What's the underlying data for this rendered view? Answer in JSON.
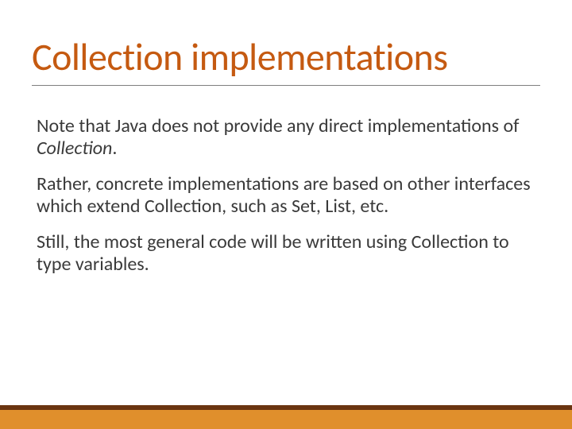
{
  "title": "Collection implementations",
  "para1_a": "Note that Java does not provide any direct implementations of ",
  "para1_b": "Collection",
  "para1_c": ". ",
  "para2": "Rather, concrete implementations are based on other interfaces which extend Collection, such as Set, List, etc.",
  "para3": "Still, the most general code will be written using Collection to type variables."
}
